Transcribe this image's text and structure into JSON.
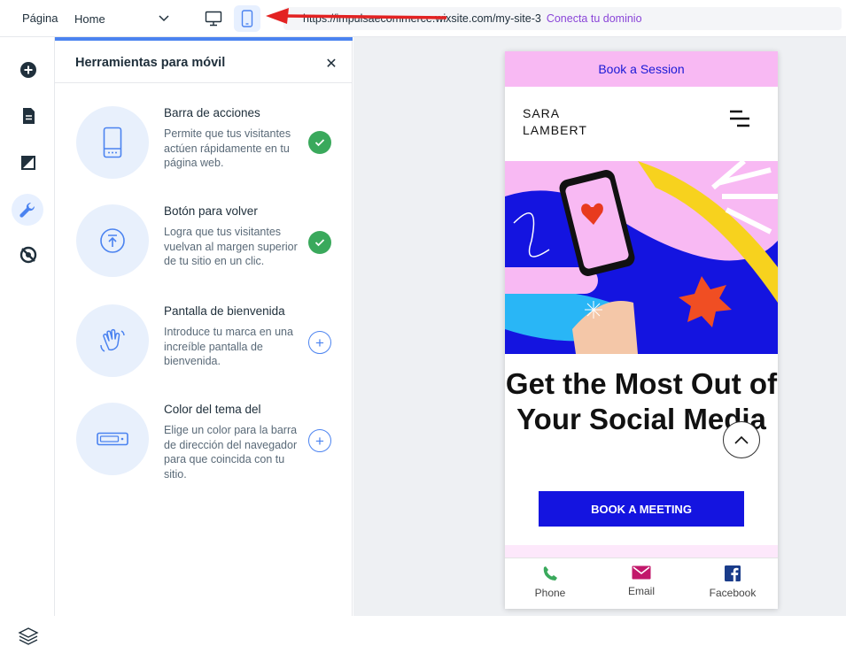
{
  "topbar": {
    "page_label": "Página",
    "page_value": "Home",
    "url": "https://impulsaecommerce.wixsite.com/my-site-3",
    "connect_domain": "Conecta tu dominio"
  },
  "panel": {
    "title": "Herramientas para móvil",
    "tools": [
      {
        "title": "Barra de acciones",
        "desc": "Permite que tus visitantes actúen rápidamente en tu página web.",
        "status": "done",
        "icon": "phone-icon"
      },
      {
        "title": "Botón para volver",
        "desc": "Logra que tus visitantes vuelvan al margen superior de tu sitio en un clic.",
        "status": "done",
        "icon": "arrow-up-circle-icon"
      },
      {
        "title": "Pantalla de bienvenida",
        "desc": "Introduce tu marca en una increíble pantalla de bienvenida.",
        "status": "add",
        "icon": "waving-hand-icon"
      },
      {
        "title": "Color del tema del",
        "desc": "Elige un color para la barra de dirección del navegador para que coincida con tu sitio.",
        "status": "add",
        "icon": "browser-bar-icon"
      }
    ]
  },
  "preview": {
    "book_session": "Book a Session",
    "brand": "SARA\nLAMBERT",
    "headline": "Get the Most Out of Your Social Media",
    "cta": "BOOK A MEETING",
    "actions": [
      {
        "label": "Phone",
        "icon": "phone-icon",
        "color": "#3aa95c"
      },
      {
        "label": "Email",
        "icon": "email-icon",
        "color": "#c2186b"
      },
      {
        "label": "Facebook",
        "icon": "facebook-icon",
        "color": "#1a3c8a"
      }
    ]
  },
  "colors": {
    "accent": "#4b83f0",
    "success": "#3aa95c",
    "connect": "#8a45d8",
    "cta": "#1414e0",
    "pink": "#f8b9f3"
  }
}
